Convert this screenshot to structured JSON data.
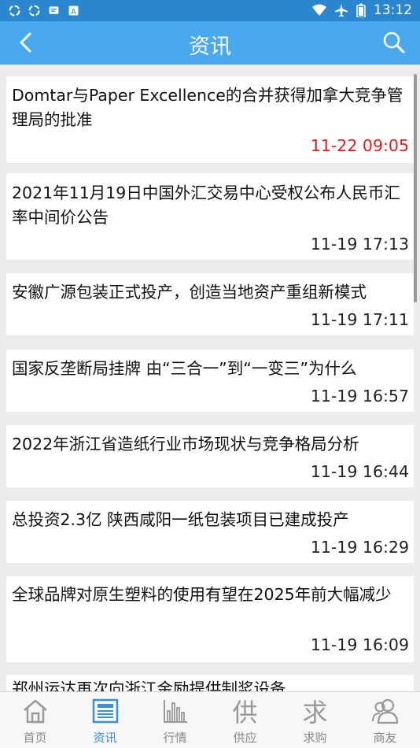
{
  "status_bar": {
    "time": "13:12"
  },
  "header": {
    "title": "资讯"
  },
  "news": [
    {
      "title": "Domtar与Paper Excellence的合并获得加拿大竞争管理局的批准",
      "time": "11-22 09:05",
      "highlight": true
    },
    {
      "title": "2021年11月19日中国外汇交易中心受权公布人民币汇率中间价公告",
      "time": "11-19 17:13",
      "highlight": false
    },
    {
      "title": "安徽广源包装正式投产，创造当地资产重组新模式",
      "time": "11-19 17:11",
      "highlight": false
    },
    {
      "title": "国家反垄断局挂牌 由“三合一”到“一变三”为什么",
      "time": "11-19 16:57",
      "highlight": false
    },
    {
      "title": "2022年浙江省造纸行业市场现状与竞争格局分析",
      "time": "11-19 16:44",
      "highlight": false
    },
    {
      "title": "总投资2.3亿 陕西咸阳一纸包装项目已建成投产",
      "time": "11-19 16:29",
      "highlight": false
    },
    {
      "title": "全球品牌对原生塑料的使用有望在2025年前大幅减少",
      "time": "11-19 16:09",
      "highlight": false
    },
    {
      "title": "郑州运达再次向浙江金励提供制浆设备",
      "time": "",
      "highlight": false
    }
  ],
  "tabs": [
    {
      "label": "首页",
      "icon": "home-icon",
      "glyph": ""
    },
    {
      "label": "资讯",
      "icon": "news-icon",
      "glyph": ""
    },
    {
      "label": "行情",
      "icon": "chart-icon",
      "glyph": ""
    },
    {
      "label": "供应",
      "icon": "supply-icon",
      "glyph": "供"
    },
    {
      "label": "求购",
      "icon": "purchase-icon",
      "glyph": "求"
    },
    {
      "label": "商友",
      "icon": "friends-icon",
      "glyph": ""
    }
  ],
  "colors": {
    "header": "#49a9ef",
    "status_bar": "#2a86cf",
    "accent": "#3b8fd6",
    "highlight_time": "#e81c1c"
  }
}
